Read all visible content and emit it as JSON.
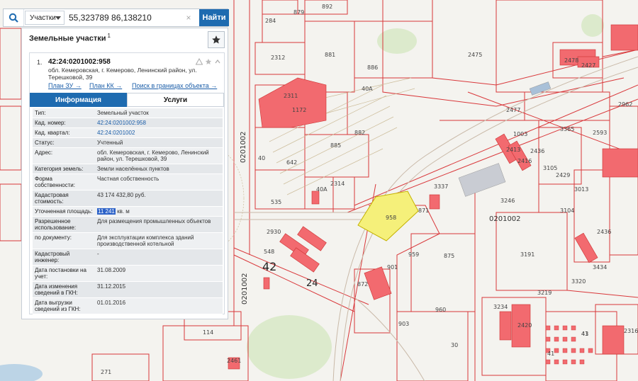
{
  "search": {
    "type_label": "Участки",
    "query": "55,323789 86,138210",
    "find_label": "Найти",
    "clear_label": "×"
  },
  "panel": {
    "title": "Земельные участки",
    "title_sup": "1",
    "result_index": "1.",
    "cad_number": "42:24:0201002:958",
    "address": "обл. Кемеровская, г. Кемерово, Ленинский район, ул. Терешковой, 39",
    "links": [
      "План ЗУ →",
      "План КК →",
      "Поиск в границах объекта →"
    ],
    "tabs": [
      "Информация",
      "Услуги"
    ],
    "properties": [
      {
        "key": "Тип:",
        "value": "Земельный участок"
      },
      {
        "key": "Кад. номер:",
        "value": "42:24:0201002:958",
        "link": true
      },
      {
        "key": "Кад. квартал:",
        "value": "42:24:0201002",
        "link": true
      },
      {
        "key": "Статус:",
        "value": "Учтенный"
      },
      {
        "key": "Адрес:",
        "value": "обл. Кемеровская, г. Кемерово, Ленинский район, ул. Терешковой, 39"
      },
      {
        "key": "Категория земель:",
        "value": "Земли населённых пунктов"
      },
      {
        "key": "Форма собственности:",
        "value": "Частная собственность"
      },
      {
        "key": "Кадастровая стоимость:",
        "value": "43 174 432,80 руб."
      },
      {
        "key": "Уточненная площадь:",
        "value_highlight": "11 241",
        "value_rest": " кв. м"
      },
      {
        "key": "Разрешенное использование:",
        "value": "Для размещения промышленных объектов"
      },
      {
        "key": "по документу:",
        "value": "Для эксплуатации комплекса зданий производственной котельной"
      },
      {
        "key": "Кадастровый инженер:",
        "value": "-"
      },
      {
        "key": "Дата постановки на учет:",
        "value": "31.08.2009"
      },
      {
        "key": "Дата изменения сведений в ГКН:",
        "value": "31.12.2015"
      },
      {
        "key": "Дата выгрузки сведений из ГКН:",
        "value": "01.01.2016"
      }
    ]
  },
  "map": {
    "labels": [
      "879",
      "892",
      "284",
      "2312",
      "881",
      "2475",
      "2478",
      "2427",
      "886",
      "40А",
      "2311",
      "1172",
      "2477",
      "2962",
      "3365",
      "2593",
      "882",
      "1003",
      "2413",
      "2436",
      "2416",
      "885",
      "3105",
      "642",
      "40",
      "2314",
      "2429",
      "3337",
      "3013",
      "40А",
      "871",
      "3246",
      "535",
      "958",
      "3104",
      "2930",
      "0201002",
      "2436",
      "42",
      "548",
      "959",
      "875",
      "3191",
      "3434",
      "901",
      "872",
      "3219",
      "3320",
      "960",
      "3234",
      "2420",
      "903",
      "30",
      "114",
      "2461",
      "271",
      "41",
      "41",
      "0201002",
      "24",
      "0201002",
      "2316",
      "43"
    ],
    "colors": {
      "plot_border": "#d9373a",
      "building": "#f26a6f",
      "selected": "#f5f07a",
      "accent": "#1e6bb0"
    }
  }
}
